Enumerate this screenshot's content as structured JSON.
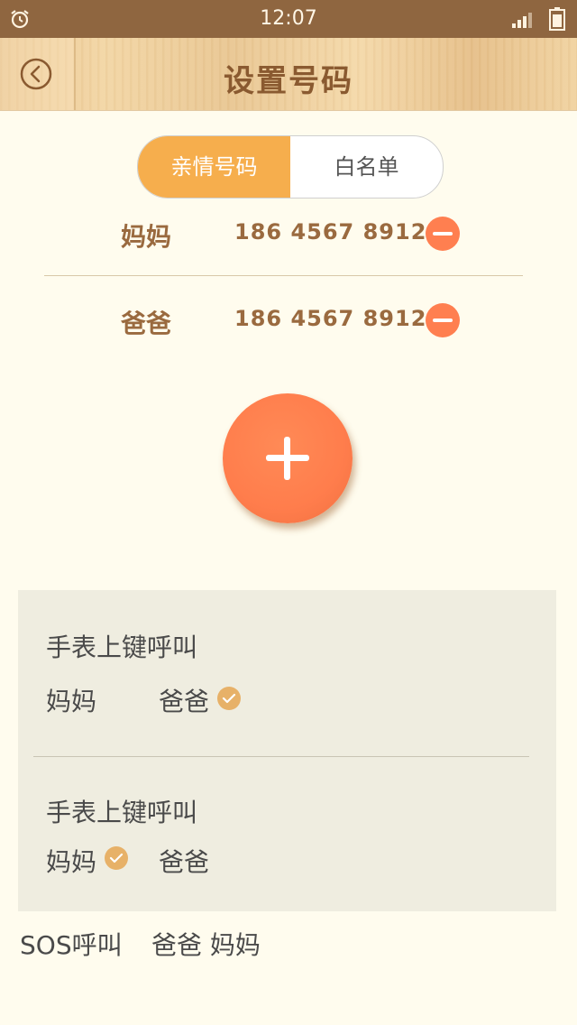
{
  "status_bar": {
    "time": "12:07",
    "icons": [
      "alarm-icon",
      "signal-icon",
      "battery-icon"
    ]
  },
  "header": {
    "title": "设置号码",
    "back_icon": "back-arrow-icon"
  },
  "segmented": {
    "tabs": [
      {
        "label": "亲情号码",
        "active": true
      },
      {
        "label": "白名单",
        "active": false
      }
    ]
  },
  "contacts": [
    {
      "name": "妈妈",
      "phone": "186 4567 8912"
    },
    {
      "name": "爸爸",
      "phone": "186 4567 8912"
    }
  ],
  "add_button": {
    "icon": "plus-icon"
  },
  "key_settings": [
    {
      "label": "手表上键呼叫",
      "options": [
        {
          "name": "妈妈",
          "checked": false
        },
        {
          "name": "爸爸",
          "checked": true
        }
      ]
    },
    {
      "label": "手表上键呼叫",
      "options": [
        {
          "name": "妈妈",
          "checked": true
        },
        {
          "name": "爸爸",
          "checked": false
        }
      ]
    }
  ],
  "sos": {
    "label": "SOS呼叫",
    "names": "爸爸 妈妈"
  },
  "colors": {
    "accent_orange": "#ff7f50",
    "tab_active": "#f6ae4d",
    "brown_text": "#9a6a3f",
    "check_gold": "#e7b168"
  }
}
